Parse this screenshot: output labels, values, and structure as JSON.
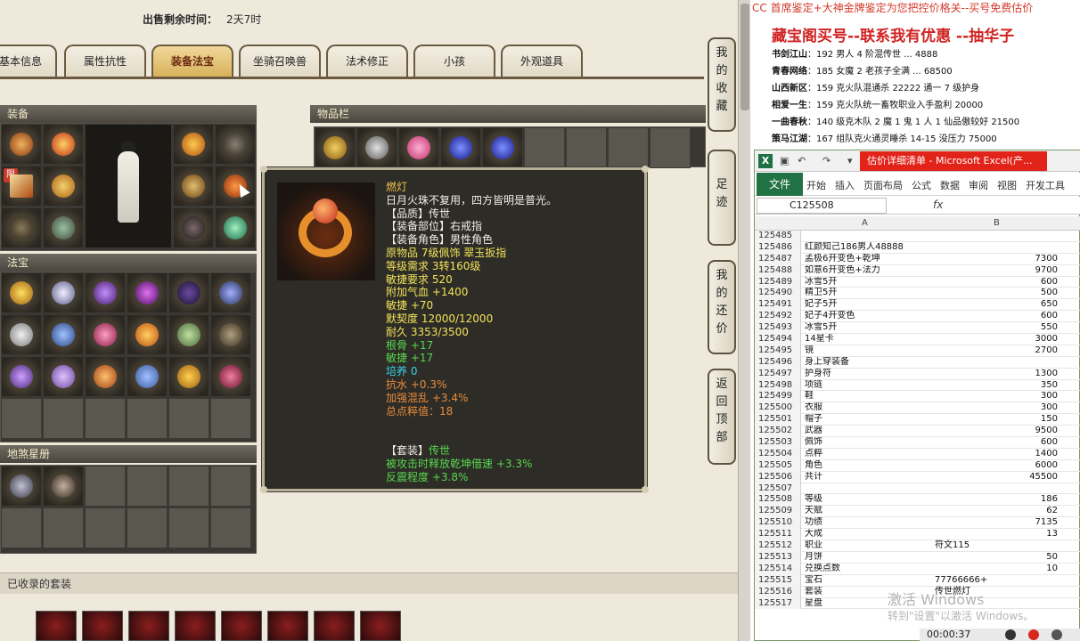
{
  "header": {
    "sale_label": "出售剩余时间：",
    "sale_value": "2天7时"
  },
  "tabs": [
    {
      "label": "基本信息",
      "active": false
    },
    {
      "label": "属性抗性",
      "active": false
    },
    {
      "label": "装备法宝",
      "active": true
    },
    {
      "label": "坐骑召唤兽",
      "active": false
    },
    {
      "label": "法术修正",
      "active": false
    },
    {
      "label": "小孩",
      "active": false
    },
    {
      "label": "外观道具",
      "active": false
    }
  ],
  "sections": {
    "equip": "装备",
    "items": "物品栏",
    "fabao": "法宝",
    "disha": "地煞星册",
    "collected": "已收录的套装"
  },
  "limit_badge": "限",
  "side_buttons": [
    {
      "name": "my-favorites-button",
      "label": [
        "我",
        "的",
        "收",
        "藏"
      ]
    },
    {
      "name": "footprint-button",
      "label": [
        "足",
        "迹"
      ]
    },
    {
      "name": "my-counteroffer-button",
      "label": [
        "我",
        "的",
        "还",
        "价"
      ]
    },
    {
      "name": "back-to-top-button",
      "label": [
        "返",
        "回",
        "顶",
        "部"
      ]
    }
  ],
  "tooltip": {
    "lines": [
      {
        "text": "燃灯",
        "cls": "gold"
      },
      {
        "text": "日月火珠不复用，四方皆明是普光。",
        "cls": "white"
      },
      {
        "text": "【品质】传世",
        "cls": "white"
      },
      {
        "text": "【装备部位】右戒指",
        "cls": "white"
      },
      {
        "text": "【装备角色】男性角色",
        "cls": "white"
      },
      {
        "text": "原物品 7级佩饰 翠玉扳指",
        "cls": "yellow"
      },
      {
        "text": "等级需求 3转160级",
        "cls": "yellow"
      },
      {
        "text": "敏捷要求 520",
        "cls": "yellow"
      },
      {
        "text": "附加气血 +1400",
        "cls": "yellow"
      },
      {
        "text": "敏捷 +70",
        "cls": "yellow"
      },
      {
        "text": "默契度 12000/12000",
        "cls": "yellow"
      },
      {
        "text": "耐久 3353/3500",
        "cls": "yellow"
      },
      {
        "text": "根骨 +17",
        "cls": "green"
      },
      {
        "text": "敏捷 +17",
        "cls": "green"
      },
      {
        "text": "培养 0",
        "cls": "cyan"
      },
      {
        "text": "抗水 +0.3%",
        "cls": "orange"
      },
      {
        "text": "加强混乱 +3.4%",
        "cls": "orange"
      },
      {
        "text": "总点粹值：18",
        "cls": "orange"
      }
    ],
    "set_label": "【套装】",
    "set_name": "传世",
    "set_lines": [
      "被攻击时释放乾坤借速 +3.3%",
      "反震程度 +3.8%"
    ]
  },
  "promo": {
    "top": "CC 首席鉴定+大神金牌鉴定为您把控价格关--买号免费估价",
    "title": "藏宝阁买号--联系我有优惠 --抽华子",
    "sellers": [
      {
        "name": "书剑江山",
        "desc": "192 男人 4 阶混传世 ... 4888"
      },
      {
        "name": "青春网络",
        "desc": "185 女魔 2 老孩子全满 ... 68500"
      },
      {
        "name": "山西新区",
        "desc": "159 克火队混通杀 22222 通一 7 级护身"
      },
      {
        "name": "相爱一生",
        "desc": "159 克火队统一畜牧职业入手盈利 20000"
      },
      {
        "name": "一曲春秋",
        "desc": "140 级克木队 2 魔 1 鬼 1 人 1 仙品傲较好 21500"
      },
      {
        "name": "策马江湖",
        "desc": "167 组队克火通灵睡杀 14-15 没压力 75000"
      }
    ]
  },
  "excel": {
    "logo": "X",
    "caption": "估价详细清单 - Microsoft Excel(产...",
    "file_tab": "文件",
    "ribbon_tabs": [
      "开始",
      "插入",
      "页面布局",
      "公式",
      "数据",
      "审阅",
      "视图",
      "开发工具"
    ],
    "name_box": "C125508",
    "fx": "fx",
    "col_headers": [
      "A",
      "B"
    ],
    "rows": [
      {
        "n": "125485",
        "a": "",
        "b": ""
      },
      {
        "n": "125486",
        "a": "红颜知己186男人48888",
        "b": ""
      },
      {
        "n": "125487",
        "a": "孟极6开变色+乾坤",
        "b": "7300"
      },
      {
        "n": "125488",
        "a": "如意6开变色+法力",
        "b": "9700"
      },
      {
        "n": "125489",
        "a": "冰雪5开",
        "b": "600"
      },
      {
        "n": "125490",
        "a": "精卫5开",
        "b": "500"
      },
      {
        "n": "125491",
        "a": "妃子5开",
        "b": "650"
      },
      {
        "n": "125492",
        "a": "妃子4开变色",
        "b": "600"
      },
      {
        "n": "125493",
        "a": "冰雪5开",
        "b": "550"
      },
      {
        "n": "125494",
        "a": "14星卡",
        "b": "3000"
      },
      {
        "n": "125495",
        "a": "镜",
        "b": "2700"
      },
      {
        "n": "125496",
        "a": "身上穿装备",
        "b": ""
      },
      {
        "n": "125497",
        "a": "护身符",
        "b": "1300"
      },
      {
        "n": "125498",
        "a": "项链",
        "b": "350"
      },
      {
        "n": "125499",
        "a": "鞋",
        "b": "300"
      },
      {
        "n": "125500",
        "a": "衣服",
        "b": "300"
      },
      {
        "n": "125501",
        "a": "帽子",
        "b": "150"
      },
      {
        "n": "125502",
        "a": "武器",
        "b": "9500"
      },
      {
        "n": "125503",
        "a": "佩饰",
        "b": "600"
      },
      {
        "n": "125504",
        "a": "点粹",
        "b": "1400"
      },
      {
        "n": "125505",
        "a": "角色",
        "b": "6000"
      },
      {
        "n": "125506",
        "a": "共计",
        "b": "45500"
      },
      {
        "n": "125507",
        "a": "",
        "b": ""
      },
      {
        "n": "125508",
        "a": "等级",
        "b": "186"
      },
      {
        "n": "125509",
        "a": "天赋",
        "b": "62"
      },
      {
        "n": "125510",
        "a": "功绩",
        "b": "7135"
      },
      {
        "n": "125511",
        "a": "大成",
        "b": "13"
      },
      {
        "n": "125512",
        "a": "职业",
        "b": "符文115",
        "left": true
      },
      {
        "n": "125513",
        "a": "月饼",
        "b": "50"
      },
      {
        "n": "125514",
        "a": "兑换点数",
        "b": "10"
      },
      {
        "n": "125515",
        "a": "宝石",
        "b": "77766666+",
        "left": true
      },
      {
        "n": "125516",
        "a": "套装",
        "b": "传世燃灯",
        "left": true
      },
      {
        "n": "125517",
        "a": "星盘",
        "b": ""
      }
    ]
  },
  "watermark": {
    "line1": "激活 Windows",
    "line2": "转到\"设置\"以激活 Windows。"
  },
  "recorder": {
    "time": "00:00:37"
  }
}
